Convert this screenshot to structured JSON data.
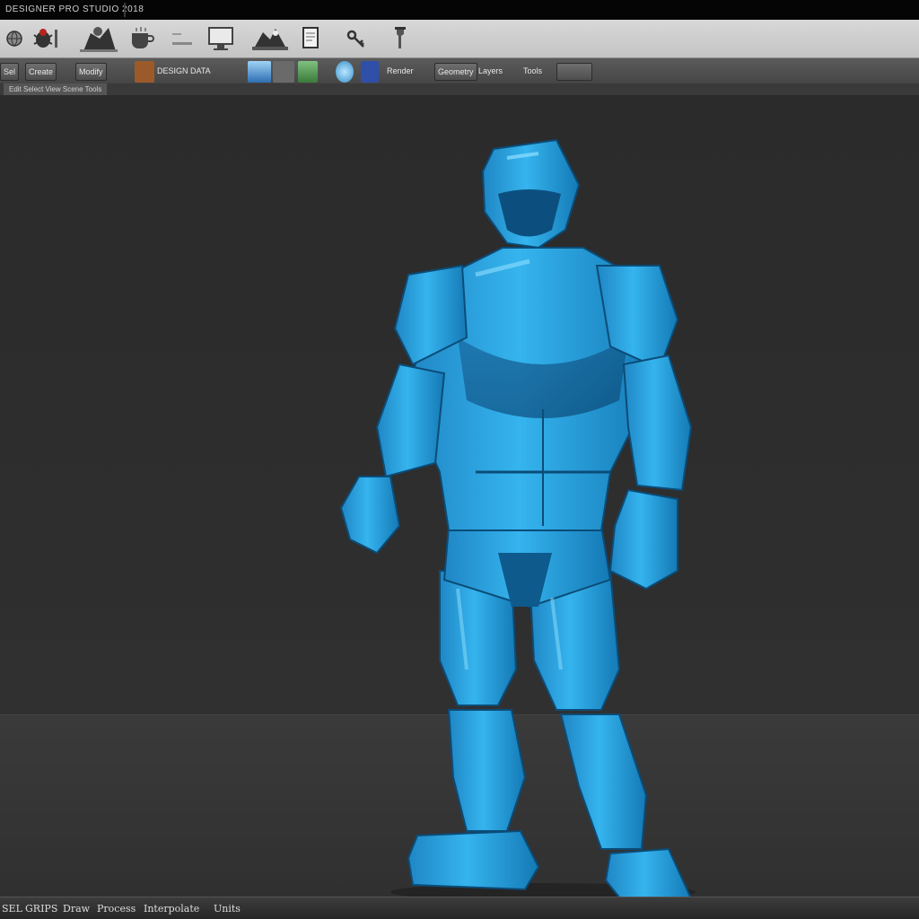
{
  "window": {
    "title": "DESIGNER PRO STUDIO 2018"
  },
  "toolbar_main": {
    "tools": [
      {
        "name": "globe-icon"
      },
      {
        "name": "bug-icon"
      },
      {
        "name": "figure-icon"
      },
      {
        "name": "coffee-icon"
      },
      {
        "name": "empty-tool-icon"
      },
      {
        "name": "monitor-icon"
      },
      {
        "name": "camera-icon"
      },
      {
        "name": "document-icon"
      },
      {
        "name": "key-icon"
      },
      {
        "name": "wrench-icon"
      }
    ]
  },
  "toolbar_secondary": {
    "items": [
      {
        "label": "Sel"
      },
      {
        "label": "Create"
      },
      {
        "label": "Modify"
      },
      {
        "label": "DESIGN DATA"
      },
      {
        "label": "Render"
      },
      {
        "label": "Geometry"
      },
      {
        "label": "Layers"
      },
      {
        "label": "Tools"
      }
    ]
  },
  "options_bar": {
    "label": "Edit  Select  View  Scene  Tools"
  },
  "statusbar": {
    "items": [
      "SEL",
      "GRIPS",
      "Draw",
      "Process",
      "Interpolate",
      "Units"
    ]
  },
  "colors": {
    "figure_primary": "#2aa8e6",
    "figure_shadow": "#0f5f92",
    "figure_highlight": "#8fe0ff"
  }
}
